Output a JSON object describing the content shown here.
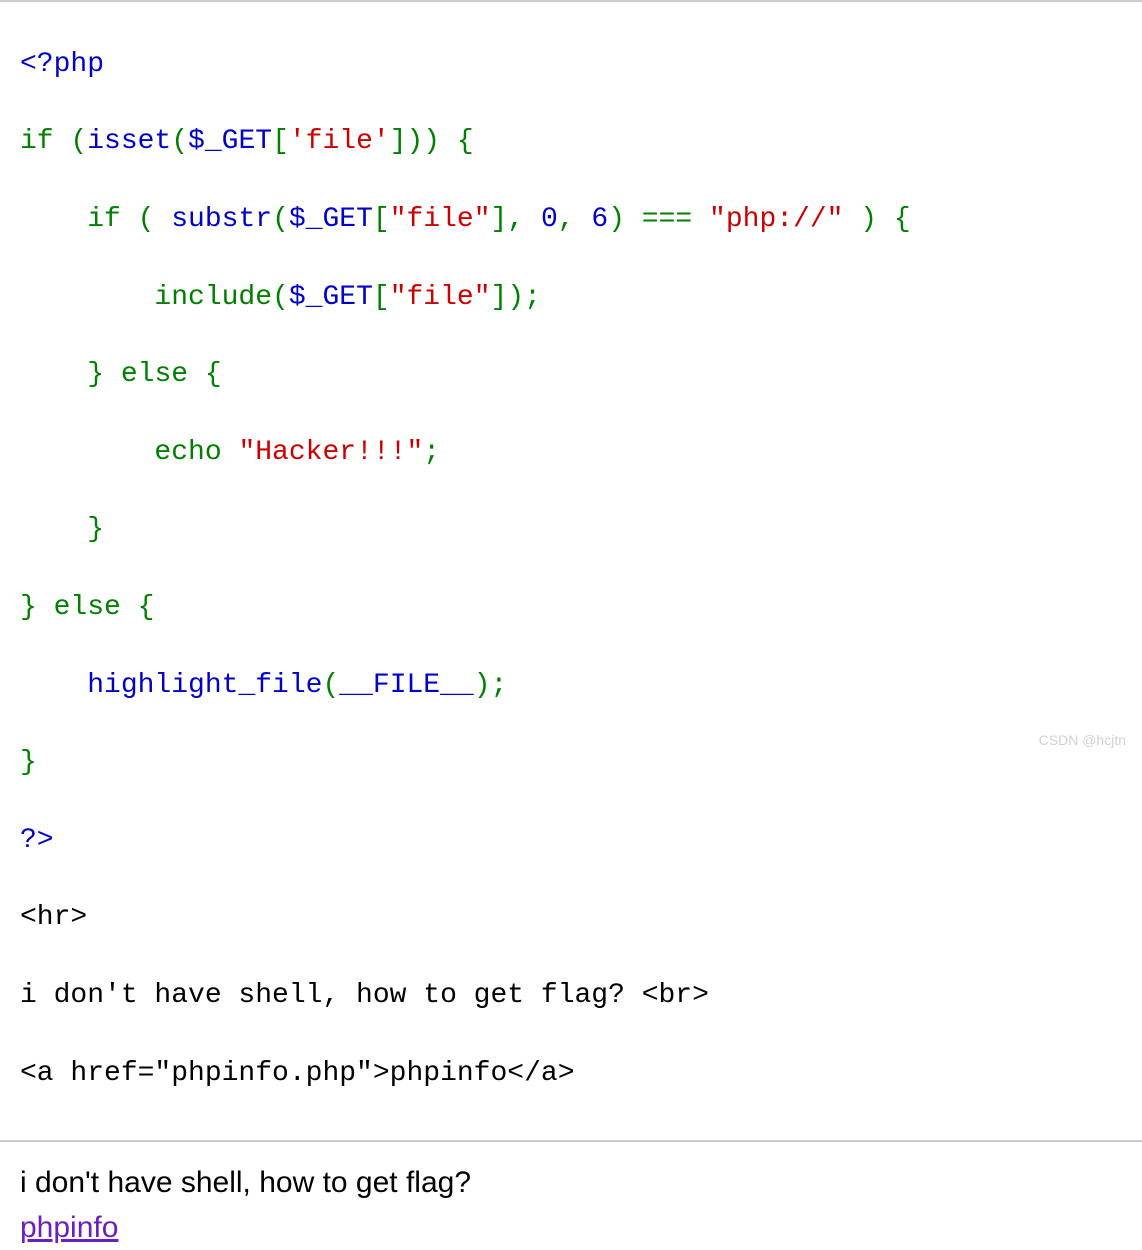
{
  "code": {
    "l1_open": "<?php",
    "l2_if": "if",
    "l2_p": " (",
    "l2_isset": "isset",
    "l2_p2": "(",
    "l2_get": "$_GET",
    "l2_b": "[",
    "l2_q1": "'file'",
    "l2_b2": "]))",
    "l2_brace": " {",
    "l3_indent": "    ",
    "l3_if": "if",
    "l3_p": " ( ",
    "l3_substr": "substr",
    "l3_p2": "(",
    "l3_get": "$_GET",
    "l3_b": "[",
    "l3_file": "\"file\"",
    "l3_b2": "], ",
    "l3_zero": "0",
    "l3_comma": ", ",
    "l3_six": "6",
    "l3_p3": ") === ",
    "l3_php": "\"php://\"",
    "l3_p4": " ) {",
    "l4_indent": "        ",
    "l4_include": "include",
    "l4_p": "(",
    "l4_get": "$_GET",
    "l4_b": "[",
    "l4_file": "\"file\"",
    "l4_b2": "]);",
    "l5_indent": "    ",
    "l5_brace": "}",
    "l5_else": " else ",
    "l5_brace2": "{",
    "l6_indent": "        ",
    "l6_echo": "echo ",
    "l6_hacker": "\"Hacker!!!\"",
    "l6_semi": ";",
    "l7_indent": "    ",
    "l7_brace": "}",
    "l8_brace": "}",
    "l8_else": " else ",
    "l8_brace2": "{",
    "l9_indent": "    ",
    "l9_hl": "highlight_file",
    "l9_p": "(",
    "l9_file": "__FILE__",
    "l9_p2": ");",
    "l10_brace": "}",
    "l11_close": "?>",
    "l12_hr": "<hr>",
    "l13": "i don't have shell, how to get flag? <br>",
    "l14": "<a href=\"phpinfo.php\">phpinfo</a>"
  },
  "body": {
    "text": "i don't have shell, how to get flag?",
    "link_text": "phpinfo",
    "link_href": "phpinfo.php"
  },
  "watermark": "CSDN @hcjtn"
}
